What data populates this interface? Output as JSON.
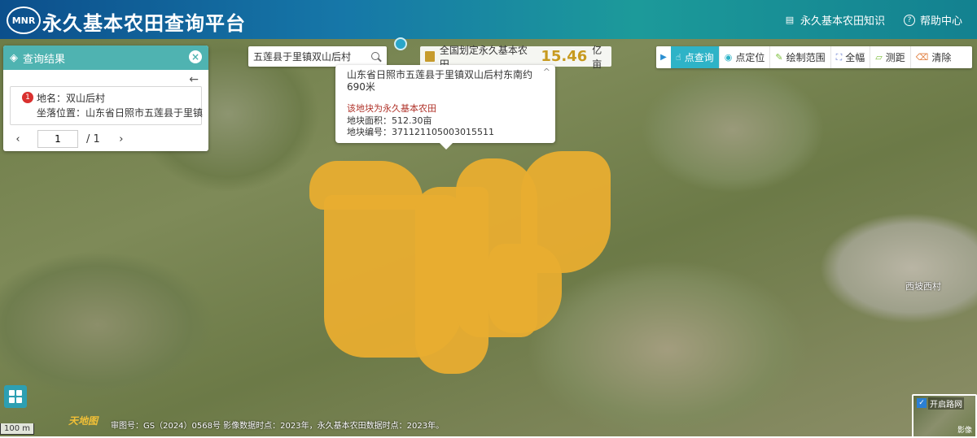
{
  "header": {
    "logo_text": "MNR",
    "title": "永久基本农田查询平台",
    "links": [
      {
        "label": "永久基本农田知识",
        "icon": "book-icon"
      },
      {
        "label": "帮助中心",
        "icon": "help-icon"
      }
    ]
  },
  "result_panel": {
    "title": "查询结果",
    "item_number": "1",
    "place_name": "地名：双山后村",
    "location": "坐落位置：山东省日照市五莲县于里镇",
    "pager": {
      "current": "1",
      "total": "/ 1"
    }
  },
  "search": {
    "value": "五莲县于里镇双山后村"
  },
  "total_box": {
    "label": "全国划定永久基本农田",
    "value": "15.46",
    "unit": "亿亩"
  },
  "popup": {
    "address": "山东省日照市五莲县于里镇双山后村东南约690米",
    "status": "该地块为永久基本农田",
    "area": "地块面积：512.30亩",
    "code": "地块编号：371121105003015511",
    "close_glyph": "^"
  },
  "toolbar": {
    "items": [
      {
        "label": "点查询",
        "icon": "pointer-icon",
        "active": true
      },
      {
        "label": "点定位",
        "icon": "pin-icon",
        "active": false
      },
      {
        "label": "绘制范围",
        "icon": "draw-icon",
        "active": false
      },
      {
        "label": "全幅",
        "icon": "fullextent-icon",
        "active": false
      },
      {
        "label": "测距",
        "icon": "ruler-icon",
        "active": false
      },
      {
        "label": "清除",
        "icon": "eraser-icon",
        "active": false
      }
    ]
  },
  "map": {
    "scale_label": "100 m",
    "provider_logo": "天地图",
    "copyright": "审图号：GS（2024）0568号 影像数据时点：2023年，永久基本农田数据时点：2023年。",
    "place_label": "西坡西村",
    "basemap_switch": {
      "label": "开启路网",
      "sub": "影像"
    },
    "field_color": "#e8ad30"
  }
}
